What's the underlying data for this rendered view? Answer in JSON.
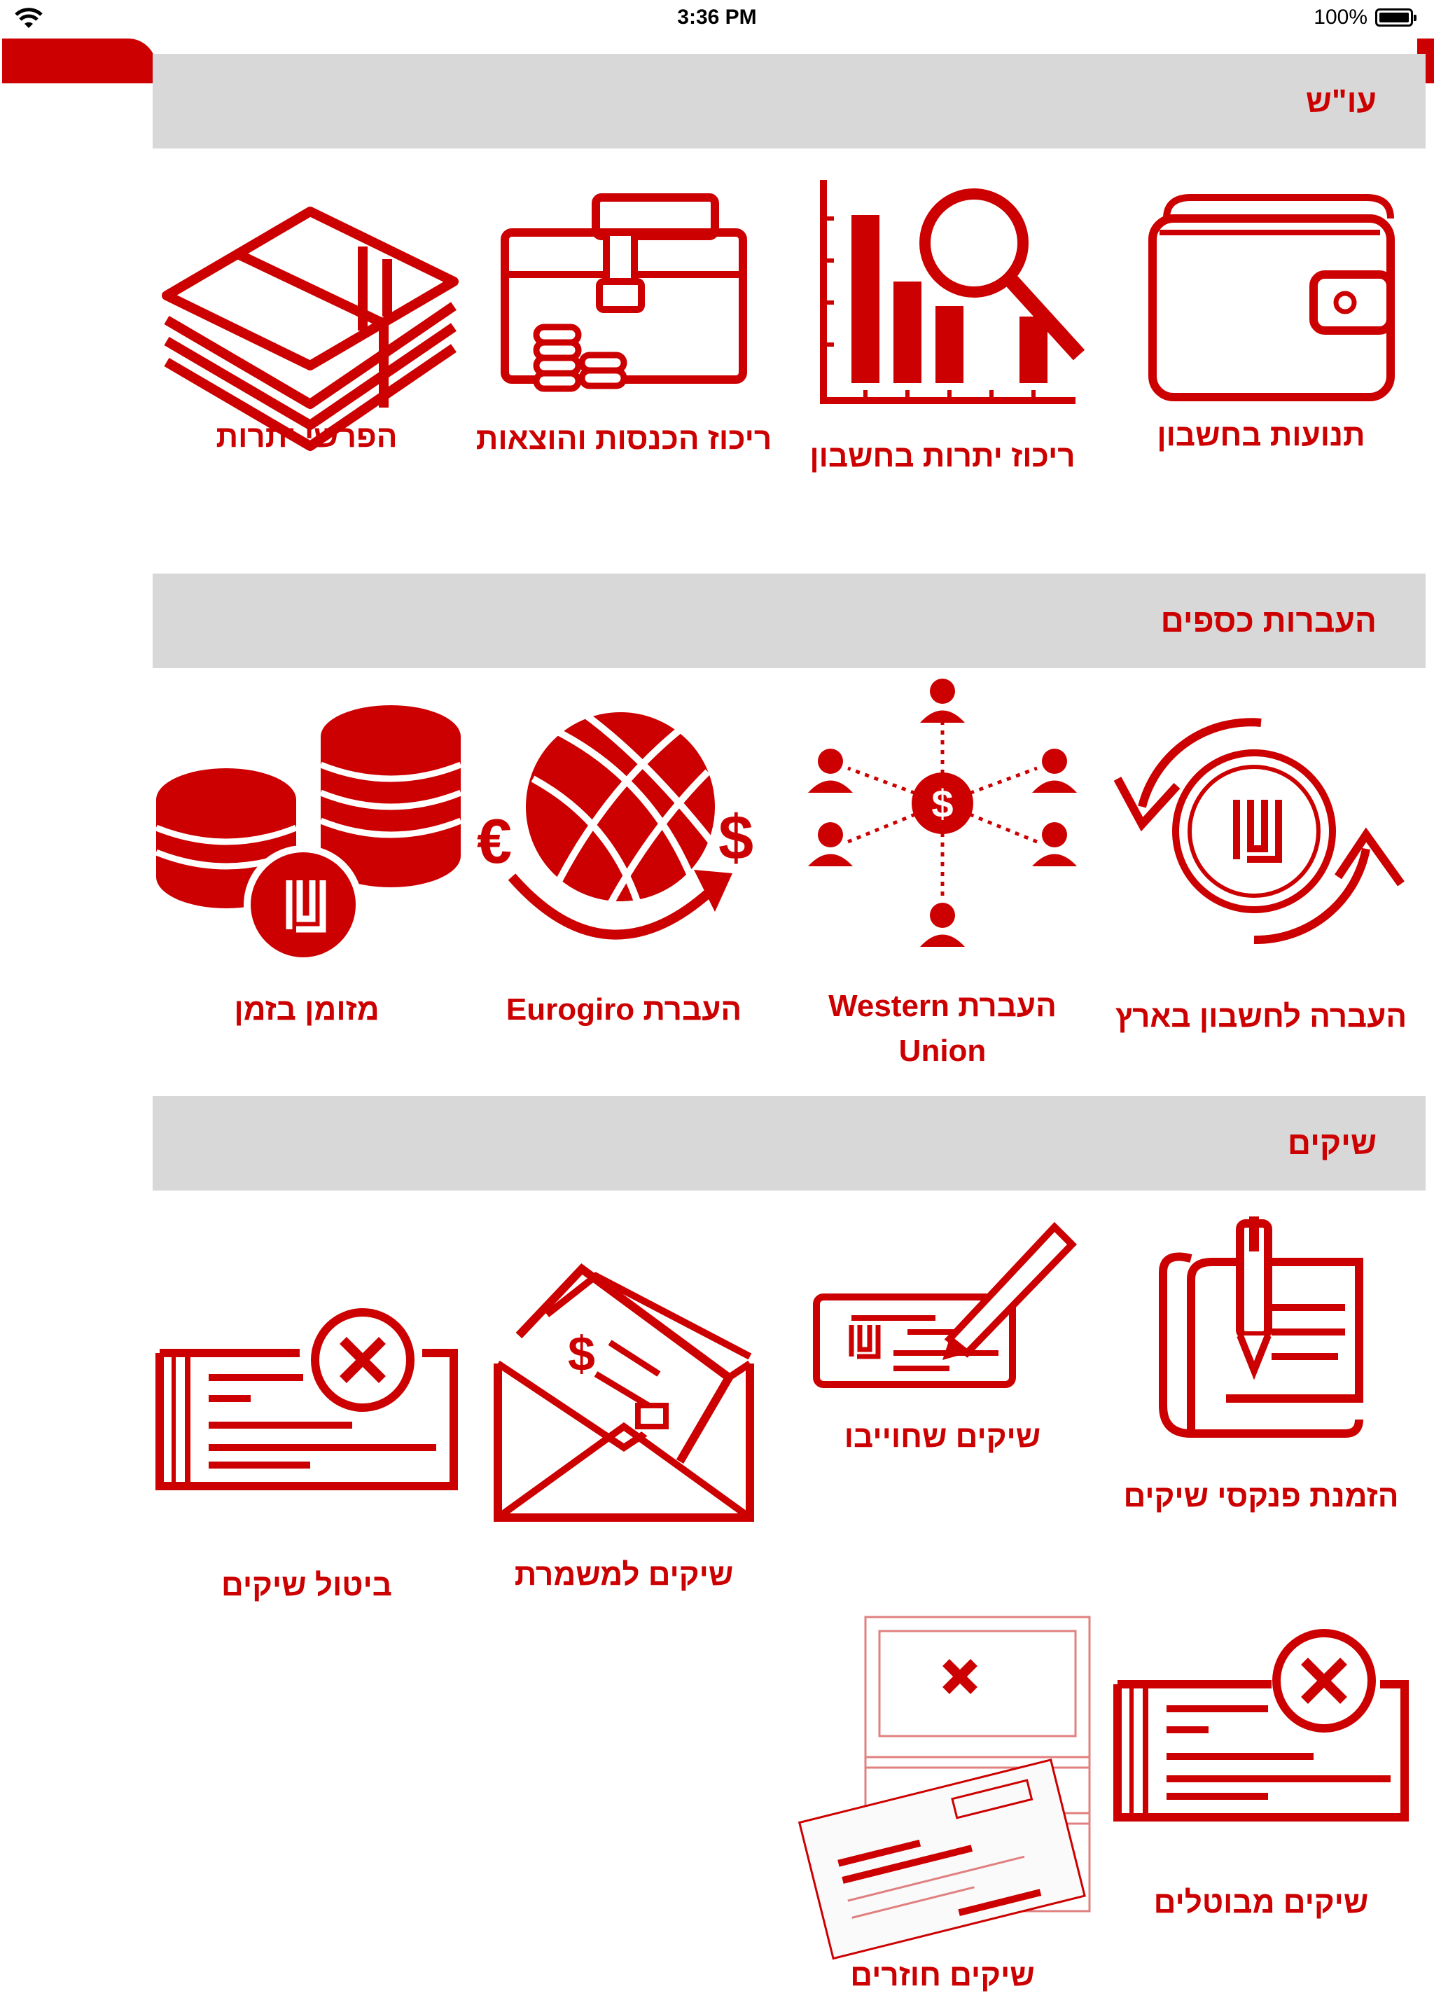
{
  "status_bar": {
    "time": "3:36 PM",
    "battery_percent": "100%",
    "icons": [
      "wifi-icon",
      "battery-icon"
    ]
  },
  "colors": {
    "accent": "#cc0000",
    "section_header_bg": "#d8d8d8",
    "background": "#ffffff"
  },
  "sections": [
    {
      "title": "עו\"ש",
      "tiles": [
        {
          "label": "תנועות בחשבון",
          "icon": "wallet-icon"
        },
        {
          "label": "ריכוז יתרות בחשבון",
          "icon": "bar-chart-search-icon"
        },
        {
          "label": "ריכוז הכנסות והוצאות",
          "icon": "briefcase-coins-icon"
        },
        {
          "label": "הפרשי יתרות",
          "icon": "money-stack-icon"
        }
      ]
    },
    {
      "title": "העברות כספים",
      "tiles": [
        {
          "label": "העברה לחשבון בארץ",
          "icon": "shekel-transfer-icon"
        },
        {
          "label": "העברת Western Union",
          "icon": "people-network-icon"
        },
        {
          "label": "העברת Eurogiro",
          "icon": "globe-currency-icon"
        },
        {
          "label": "מזומן בזמן",
          "icon": "coin-stacks-icon"
        }
      ]
    },
    {
      "title": "שיקים",
      "tiles": [
        {
          "label": "הזמנת פנקסי שיקים",
          "icon": "checkbook-pen-icon"
        },
        {
          "label": "שיקים שחוייבו",
          "icon": "signed-check-icon"
        },
        {
          "label": "שיקים למשמרת",
          "icon": "check-envelope-icon"
        },
        {
          "label": "ביטול שיקים",
          "icon": "cancel-check-icon"
        }
      ],
      "extra_tiles": [
        {
          "label": "שיקים מבוטלים",
          "icon": "cancelled-check-icon"
        },
        {
          "label": "שיקים חוזרים",
          "icon": "returned-check-icon"
        }
      ]
    }
  ]
}
